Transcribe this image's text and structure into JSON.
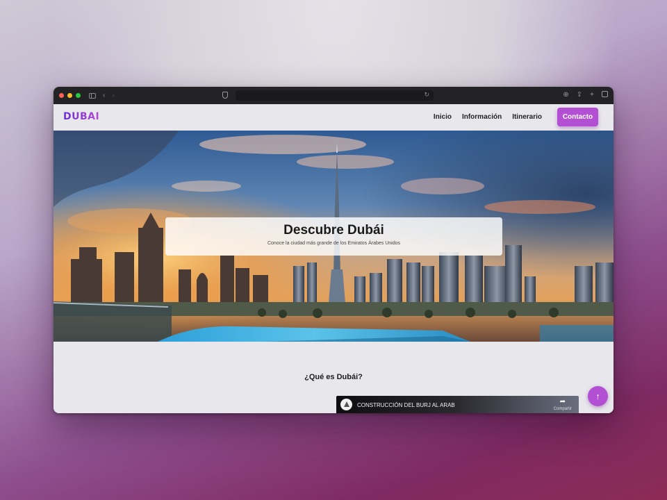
{
  "browser": {
    "nav_back": "‹",
    "nav_forward": "›",
    "reload": "↻"
  },
  "navbar": {
    "logo": "DUBAI",
    "links": [
      "Inicio",
      "Información",
      "Itinerario"
    ],
    "contact_label": "Contacto"
  },
  "hero": {
    "title": "Descubre Dubái",
    "subtitle": "Conoce la ciudad más grande de los Emiratos Árabes Unidos"
  },
  "section": {
    "title": "¿Qué es Dubái?"
  },
  "video": {
    "title": "CONSTRUCCIÓN DEL BURJ AL ARAB",
    "share_label": "Compartir"
  },
  "scroll_top_icon": "↑",
  "colors": {
    "accent": "#b24fd2",
    "logo_gradient_start": "#6a2fd6",
    "logo_gradient_end": "#b54bd4"
  }
}
